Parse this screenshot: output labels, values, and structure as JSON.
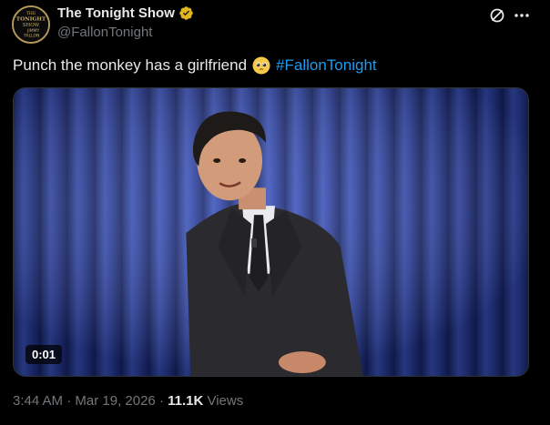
{
  "header": {
    "display_name": "The Tonight Show",
    "handle": "@FallonTonight",
    "avatar_text": [
      "THE",
      "TONIGHT",
      "SHOW",
      "JIMMY",
      "FALLON"
    ],
    "verified": true
  },
  "tweet": {
    "text": "Punch the monkey has a girlfriend",
    "emoji": "pleading-face-emoji",
    "hashtag": "#FallonTonight"
  },
  "media": {
    "duration": "0:01"
  },
  "meta": {
    "time": "3:44 AM",
    "sep1": " · ",
    "date": "Mar 19, 2026",
    "sep2": " · ",
    "views_count": "11.1K",
    "views_label": " Views"
  },
  "colors": {
    "accent": "#1d9bf0",
    "verified_gold": "#e2b719",
    "secondary_text": "#71767b",
    "curtain": "#2a3f9a"
  },
  "icons": [
    "grok-icon",
    "more-icon",
    "verified-badge-icon"
  ]
}
